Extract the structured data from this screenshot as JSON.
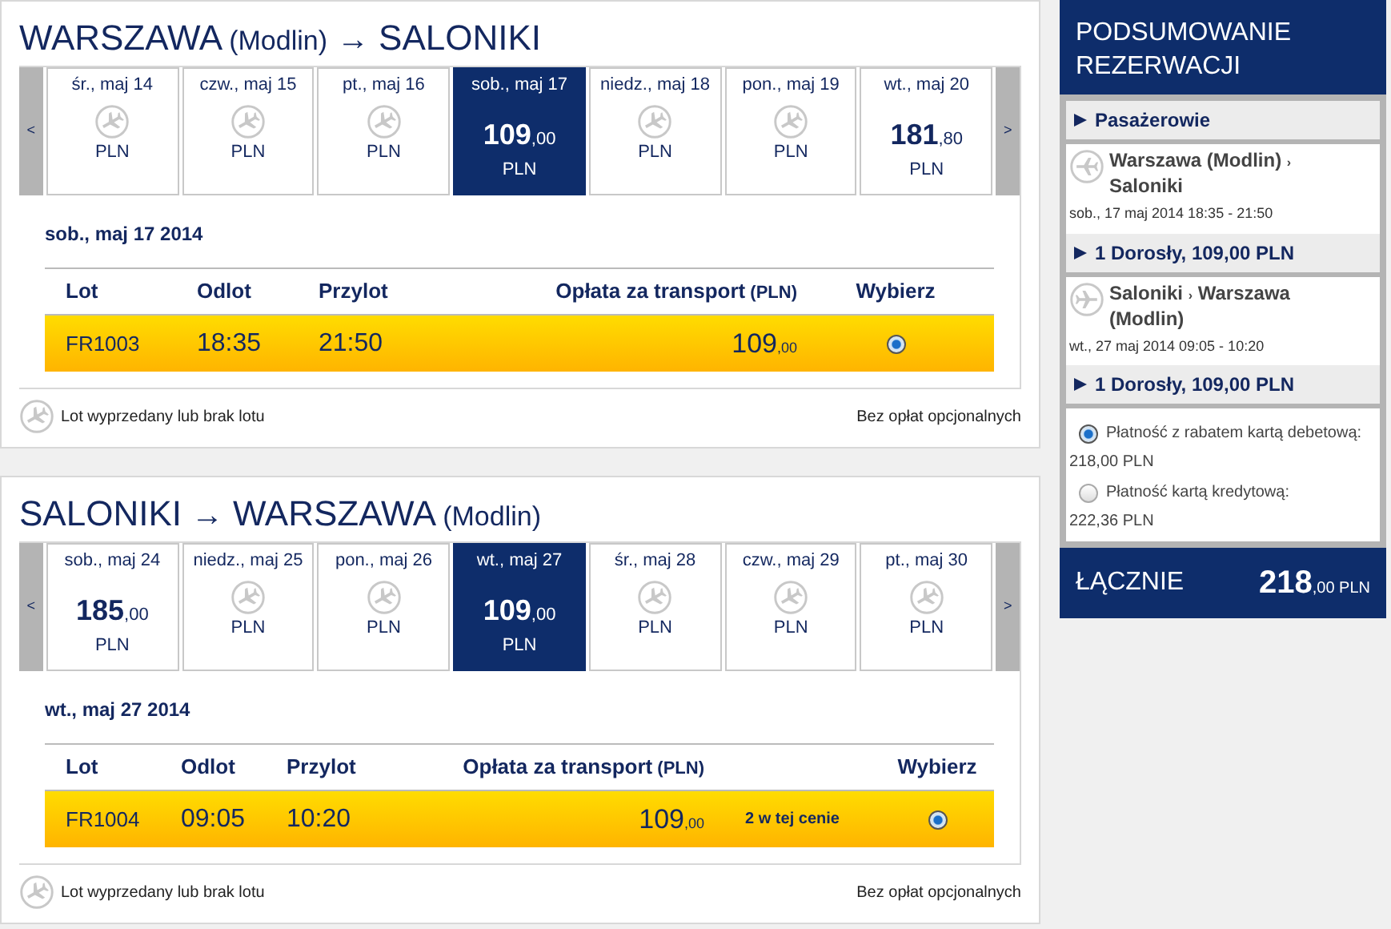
{
  "journeys": [
    {
      "title": [
        {
          "kind": "main",
          "text": "WARSZAWA"
        },
        {
          "kind": "sub",
          "text": "(Modlin)"
        },
        {
          "kind": "arrow",
          "text": "→"
        },
        {
          "kind": "main",
          "text": "SALONIKI"
        }
      ],
      "prev": "<",
      "next": ">",
      "dates": [
        {
          "label": "śr., maj 14",
          "available": false,
          "selected": false,
          "currency": "PLN"
        },
        {
          "label": "czw., maj 15",
          "available": false,
          "selected": false,
          "currency": "PLN"
        },
        {
          "label": "pt., maj 16",
          "available": false,
          "selected": false,
          "currency": "PLN"
        },
        {
          "label": "sob., maj 17",
          "available": true,
          "selected": true,
          "price": "109",
          "decimals": ",00",
          "currency": "PLN"
        },
        {
          "label": "niedz., maj 18",
          "available": false,
          "selected": false,
          "currency": "PLN"
        },
        {
          "label": "pon., maj 19",
          "available": false,
          "selected": false,
          "currency": "PLN"
        },
        {
          "label": "wt., maj 20",
          "available": true,
          "selected": false,
          "price": "181",
          "decimals": ",80",
          "currency": "PLN"
        }
      ],
      "date_heading": "sob., maj 17 2014",
      "columns": [
        {
          "label": "Lot"
        },
        {
          "label": "Odlot"
        },
        {
          "label": "Przylot"
        },
        {
          "label": "Opłata za transport",
          "unit": "(PLN)"
        },
        {
          "label": "Wybierz"
        }
      ],
      "rows": [
        {
          "flight": "FR1003",
          "departure": "18:35",
          "arrival": "21:50",
          "price": "109",
          "decimals": ",00",
          "selected": true
        }
      ],
      "legend": "Lot wyprzedany lub brak lotu",
      "fees_note": "Bez opłat opcjonalnych"
    },
    {
      "title": [
        {
          "kind": "main",
          "text": "SALONIKI"
        },
        {
          "kind": "arrow",
          "text": "→"
        },
        {
          "kind": "main",
          "text": "WARSZAWA"
        },
        {
          "kind": "sub",
          "text": "(Modlin)"
        }
      ],
      "prev": "<",
      "next": ">",
      "dates": [
        {
          "label": "sob., maj 24",
          "available": true,
          "selected": false,
          "price": "185",
          "decimals": ",00",
          "currency": "PLN"
        },
        {
          "label": "niedz., maj 25",
          "available": false,
          "selected": false,
          "currency": "PLN"
        },
        {
          "label": "pon., maj 26",
          "available": false,
          "selected": false,
          "currency": "PLN"
        },
        {
          "label": "wt., maj 27",
          "available": true,
          "selected": true,
          "price": "109",
          "decimals": ",00",
          "currency": "PLN"
        },
        {
          "label": "śr., maj 28",
          "available": false,
          "selected": false,
          "currency": "PLN"
        },
        {
          "label": "czw., maj 29",
          "available": false,
          "selected": false,
          "currency": "PLN"
        },
        {
          "label": "pt., maj 30",
          "available": false,
          "selected": false,
          "currency": "PLN"
        }
      ],
      "date_heading": "wt., maj 27 2014",
      "columns": [
        {
          "label": "Lot"
        },
        {
          "label": "Odlot"
        },
        {
          "label": "Przylot"
        },
        {
          "label": "Opłata za transport",
          "unit": "(PLN)"
        },
        {
          "label": "Wybierz"
        }
      ],
      "rows": [
        {
          "flight": "FR1004",
          "departure": "09:05",
          "arrival": "10:20",
          "price": "109",
          "decimals": ",00",
          "note": "2 w tej cenie",
          "selected": true
        }
      ],
      "legend": "Lot wyprzedany lub brak lotu",
      "fees_note": "Bez opłat opcjonalnych"
    }
  ],
  "summary": {
    "title": "PODSUMOWANIE REZERWACJI",
    "passengers": "Pasażerowie",
    "segments": [
      {
        "from": "Warszawa (Modlin)",
        "separator": "›",
        "to": "Saloniki",
        "datetime": "sob., 17 maj 2014 18:35 - 21:50",
        "fare": "1 Dorosły, 109,00 PLN"
      },
      {
        "from": "Saloniki",
        "separator": "›",
        "to": "Warszawa (Modlin)",
        "datetime": "wt., 27 maj 2014 09:05 - 10:20",
        "fare": "1 Dorosły, 109,00 PLN"
      }
    ],
    "payments": [
      {
        "label": "Płatność z rabatem kartą debetową:",
        "amount": "218,00 PLN",
        "selected": true
      },
      {
        "label": "Płatność kartą kredytową:",
        "amount": "222,36 PLN",
        "selected": false
      }
    ],
    "total": {
      "label": "ŁĄCZNIE",
      "price": "218",
      "decimals": ",00",
      "currency": "PLN"
    }
  }
}
